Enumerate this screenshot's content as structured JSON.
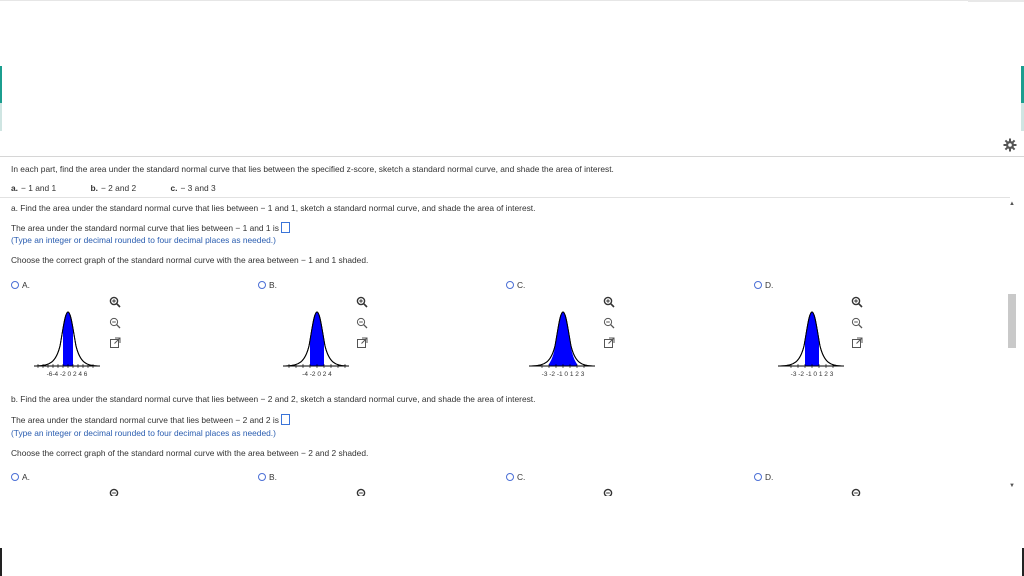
{
  "instructions": "In each part, find the area under the standard normal curve that lies between the specified z-score, sketch a standard normal curve, and shade the area of interest.",
  "parts": [
    {
      "letter": "a.",
      "text": "− 1 and 1"
    },
    {
      "letter": "b.",
      "text": "− 2 and 2"
    },
    {
      "letter": "c.",
      "text": "− 3 and 3"
    }
  ],
  "part_a": {
    "prompt": "a. Find the area under the standard normal curve that lies between − 1 and 1, sketch a standard normal curve, and shade the area of interest.",
    "area_text": "The area under the standard normal curve that lies between − 1 and 1 is",
    "hint": "(Type an integer or decimal rounded to four decimal places as needed.)",
    "choose": "Choose the correct graph of the standard normal curve with the area between − 1 and 1 shaded.",
    "options": [
      {
        "label": "A.",
        "axis": "-6-4 -2 0 2 4 6"
      },
      {
        "label": "B.",
        "axis": "-4 -2 0 2 4"
      },
      {
        "label": "C.",
        "axis": "-3 -2 -1 0 1 2 3"
      },
      {
        "label": "D.",
        "axis": "-3 -2 -1 0 1 2 3"
      }
    ]
  },
  "part_b": {
    "prompt": "b. Find the area under the standard normal curve that lies between − 2 and 2, sketch a standard normal curve, and shade the area of interest.",
    "area_text": "The area under the standard normal curve that lies between − 2 and 2 is",
    "hint": "(Type an integer or decimal rounded to four decimal places as needed.)",
    "choose": "Choose the correct graph of the standard normal curve with the area between − 2 and 2 shaded.",
    "options": [
      {
        "label": "A."
      },
      {
        "label": "B."
      },
      {
        "label": "C."
      },
      {
        "label": "D."
      }
    ]
  },
  "icons": {
    "settings": "gear-icon",
    "zoom_in": "zoom-in-icon",
    "zoom_out": "zoom-out-icon",
    "popout": "popout-icon"
  },
  "colors": {
    "shade": "#0000ff",
    "accent": "#1b9e8f",
    "link": "#2a5db0"
  }
}
